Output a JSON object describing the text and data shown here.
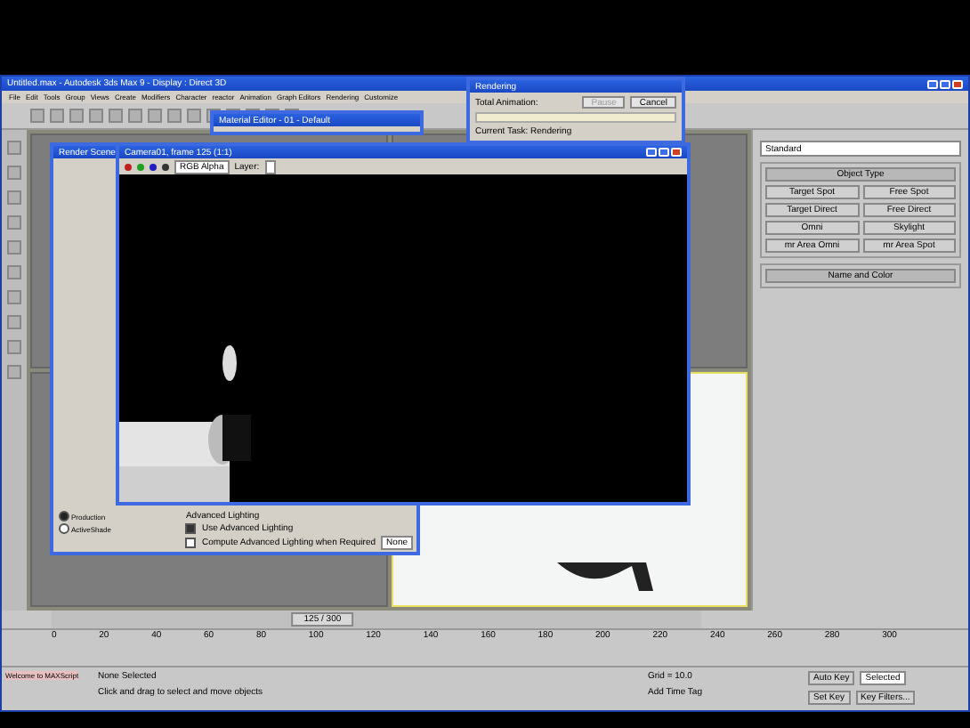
{
  "main_window": {
    "title": "Untitled.max - Autodesk 3ds Max 9 - Display : Direct 3D"
  },
  "menu": [
    "File",
    "Edit",
    "Tools",
    "Group",
    "Views",
    "Create",
    "Modifiers",
    "Character",
    "reactor",
    "Animation",
    "Graph Editors",
    "Rendering",
    "Customize"
  ],
  "material_editor": {
    "title": "Material Editor - 01 - Default"
  },
  "command_panel": {
    "dropdown": "Standard",
    "rollouts": [
      {
        "title": "Object Type",
        "buttons": [
          "Target Spot",
          "Free Spot",
          "Target Direct",
          "Free Direct",
          "Omni",
          "Skylight",
          "mr Area Omni",
          "mr Area Spot"
        ]
      },
      {
        "title": "Name and Color"
      }
    ]
  },
  "render_setup": {
    "title": "Render Scene",
    "modes": [
      {
        "label": "Production",
        "selected": true
      },
      {
        "label": "ActiveShade",
        "selected": false
      }
    ],
    "advanced_title": "Advanced Lighting",
    "advanced": [
      {
        "label": "Use Advanced Lighting",
        "checked": true
      },
      {
        "label": "Compute Advanced Lighting when Required",
        "checked": false
      }
    ],
    "lighting_dropdown": "None"
  },
  "frame_window": {
    "title": "Camera01, frame 125 (1:1)",
    "channel": "RGB Alpha",
    "layer_label": "Layer:"
  },
  "progress": {
    "title": "Rendering",
    "total_label": "Total Animation:",
    "level": 0,
    "pause": {
      "label": "Pause",
      "disabled": true
    },
    "cancel": {
      "label": "Cancel",
      "disabled": false
    },
    "task": "Current Task:   Rendering"
  },
  "timeline": {
    "slider": "125 / 300",
    "level": 0.417,
    "ticks": [
      "0",
      "20",
      "40",
      "60",
      "80",
      "100",
      "120",
      "140",
      "160",
      "180",
      "200",
      "220",
      "240",
      "260",
      "280",
      "300"
    ]
  },
  "status": {
    "maxscript": "Welcome to MAXScript",
    "selection": "None Selected",
    "prompt": "Click and drag to select and move objects",
    "grid": "Grid = 10.0",
    "time_tag": "Add Time Tag",
    "auto_key": "Auto Key",
    "key_mode": "Selected",
    "set_key": "Set Key",
    "key_filters": "Key Filters..."
  }
}
